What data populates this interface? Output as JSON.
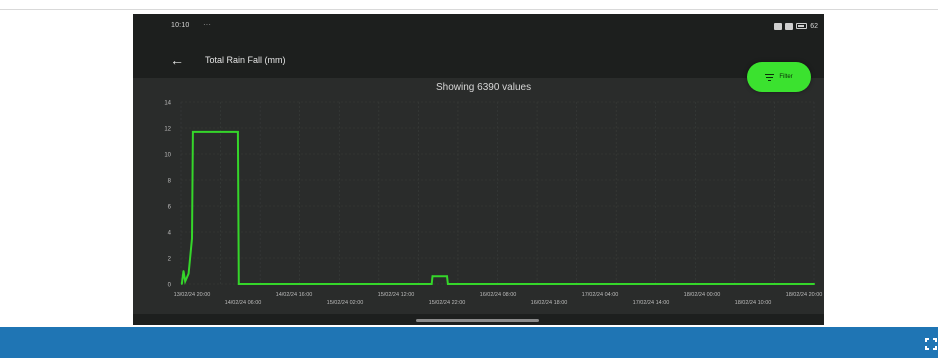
{
  "status_bar": {
    "time": "10:10",
    "extra": "···",
    "battery": "62"
  },
  "app_bar": {
    "back_icon": "arrow-left-icon",
    "title": "Total Rain Fall (mm)"
  },
  "chart_info": {
    "showing_text": "Showing 6390 values"
  },
  "filter_button": {
    "label": "Filter",
    "icon": "filter-icon",
    "color": "#3be22f"
  },
  "colors": {
    "line": "#35d62a",
    "chart_bg": "#2a2c2b",
    "footer": "#1f75b4"
  },
  "footer": {
    "fullscreen_icon": "fullscreen-icon"
  },
  "chart_data": {
    "type": "line",
    "title": "",
    "ylabel": "",
    "xlabel": "",
    "ylim": [
      0,
      14
    ],
    "yticks": [
      0,
      2,
      4,
      6,
      8,
      10,
      12,
      14
    ],
    "grid": true,
    "xticks_row1": [
      "13/02/24 20:00",
      "14/02/24 16:00",
      "15/02/24 12:00",
      "16/02/24 08:00",
      "17/02/24 04:00",
      "18/02/24 00:00",
      "18/02/24 20:00"
    ],
    "xticks_row2": [
      "14/02/24 06:00",
      "15/02/24 02:00",
      "15/02/24 22:00",
      "16/02/24 18:00",
      "17/02/24 14:00",
      "18/02/24 10:00"
    ],
    "x_range": [
      "13/02/24 20:00",
      "18/02/24 20:00"
    ],
    "series": [
      {
        "points": [
          [
            "13/02/24 18:00",
            0
          ],
          [
            "13/02/24 18:20",
            1.0
          ],
          [
            "13/02/24 18:40",
            0.2
          ],
          [
            "13/02/24 19:20",
            0.8
          ],
          [
            "13/02/24 20:00",
            3.5
          ],
          [
            "13/02/24 20:10",
            11.7
          ],
          [
            "14/02/24 05:00",
            11.7
          ],
          [
            "14/02/24 05:10",
            0
          ],
          [
            "14/02/24 09:00",
            0
          ],
          [
            "15/02/24 19:00",
            0
          ],
          [
            "15/02/24 19:10",
            0.6
          ],
          [
            "15/02/24 22:00",
            0.6
          ],
          [
            "15/02/24 22:10",
            0
          ],
          [
            "18/02/24 22:00",
            0
          ]
        ]
      }
    ]
  }
}
